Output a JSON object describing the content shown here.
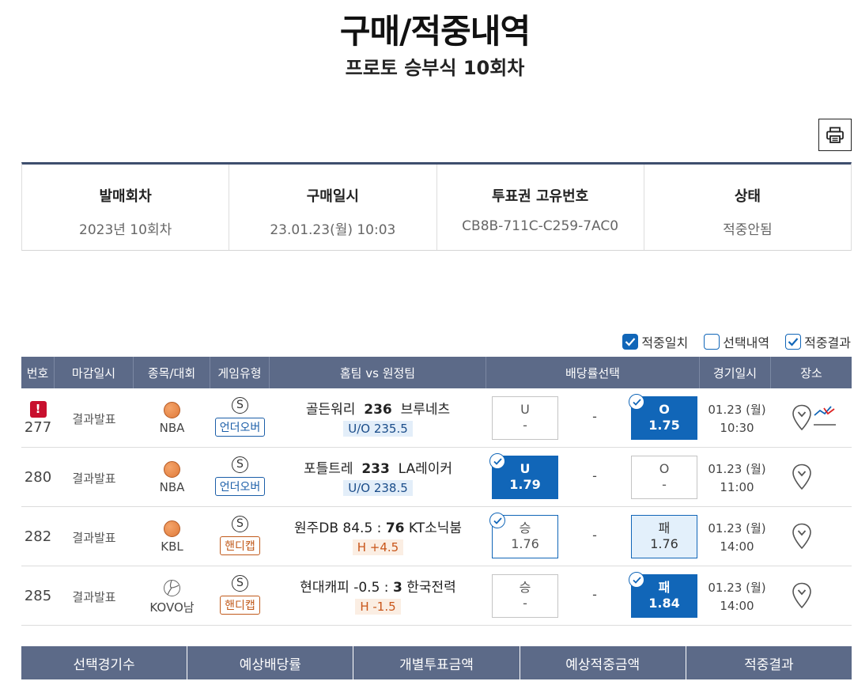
{
  "header": {
    "title": "구매/적중내역",
    "subtitle": "프로토 승부식 10회차"
  },
  "summary": [
    {
      "label": "발매회차",
      "value": "2023년 10회차"
    },
    {
      "label": "구매일시",
      "value": "23.01.23(월) 10:03"
    },
    {
      "label": "투표권 고유번호",
      "value": "CB8B-711C-C259-7AC0"
    },
    {
      "label": "상태",
      "value": "적중안됨"
    }
  ],
  "filters": [
    {
      "label": "적중일치",
      "state": "checked"
    },
    {
      "label": "선택내역",
      "state": "unchecked"
    },
    {
      "label": "적중결과",
      "state": "ring-checked"
    }
  ],
  "table_headers": [
    "번호",
    "마감일시",
    "종목/대회",
    "게임유형",
    "홈팀 vs 원정팀",
    "배당률선택",
    "경기일시",
    "장소"
  ],
  "game_type_icon_letter": "S",
  "rows": [
    {
      "number": "277",
      "deadline": "결과발표",
      "league": "NBA",
      "game_type": "언더오버",
      "home": "골든워리",
      "score": "236",
      "away": "브루네츠",
      "sep": "",
      "line": "U/O 235.5",
      "opt1_label": "U",
      "opt1_odds": "-",
      "mid": "-",
      "opt2_label": "O",
      "opt2_odds": "1.75",
      "date": "01.23 (월)",
      "time": "10:30"
    },
    {
      "number": "280",
      "deadline": "결과발표",
      "league": "NBA",
      "game_type": "언더오버",
      "home": "포틀트레",
      "score": "233",
      "away": "LA레이커",
      "sep": "",
      "line": "U/O 238.5",
      "opt1_label": "U",
      "opt1_odds": "1.79",
      "mid": "-",
      "opt2_label": "O",
      "opt2_odds": "-",
      "date": "01.23 (월)",
      "time": "11:00"
    },
    {
      "number": "282",
      "deadline": "결과발표",
      "league": "KBL",
      "game_type": "핸디캡",
      "home": "원주DB 84.5",
      "score": "76",
      "away": "KT소닉붐",
      "sep": ":",
      "line": "H +4.5",
      "opt1_label": "승",
      "opt1_odds": "1.76",
      "mid": "-",
      "opt2_label": "패",
      "opt2_odds": "1.76",
      "date": "01.23 (월)",
      "time": "14:00"
    },
    {
      "number": "285",
      "deadline": "결과발표",
      "league": "KOVO남",
      "game_type": "핸디캡",
      "home": "현대캐피 -0.5",
      "score": "3",
      "away": "한국전력",
      "sep": ":",
      "line": "H -1.5",
      "opt1_label": "승",
      "opt1_odds": "-",
      "mid": "-",
      "opt2_label": "패",
      "opt2_odds": "1.84",
      "date": "01.23 (월)",
      "time": "14:00"
    }
  ],
  "bottom_headers": [
    "선택경기수",
    "예상배당률",
    "개별투표금액",
    "예상적중금액",
    "적중결과"
  ],
  "icons": {
    "print": "printer-icon",
    "warning": "warning-icon",
    "location": "location-pin-icon",
    "chart": "trend-chart-icon"
  },
  "colors": {
    "accent": "#1166b8",
    "header_bg": "#5c6a88",
    "handicap": "#c15a1b"
  }
}
